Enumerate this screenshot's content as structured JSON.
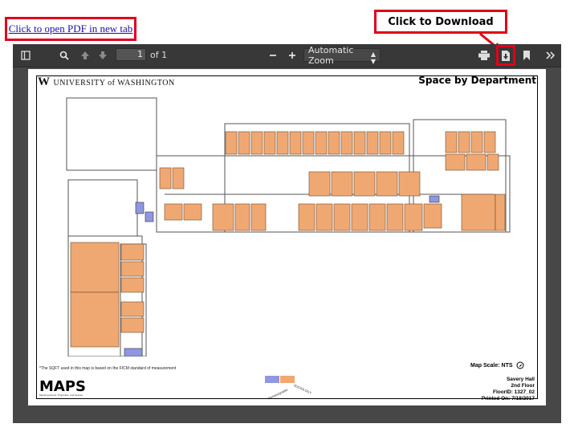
{
  "open_pdf_link": "Click to open PDF in new tab",
  "download_callout": "Click to Download",
  "toolbar": {
    "page_number": "1",
    "page_count": "of 1",
    "zoom": "Automatic Zoom",
    "icons": [
      "sidebar-toggle-icon",
      "search-icon",
      "prev-page-icon",
      "next-page-icon",
      "zoom-out-icon",
      "zoom-in-icon",
      "print-icon",
      "download-icon",
      "bookmark-icon",
      "tools-icon"
    ]
  },
  "document": {
    "logo_text": "UNIVERSITY of WASHINGTON",
    "logo_mark": "W",
    "title": "Space by Department",
    "footnote": "*The SQFT used in this map is based on the FICM standard of measurement",
    "map_scale": "Map Scale: NTS",
    "maps_logo": "MAPS",
    "maps_subtitle": "Mapping Assets, Properties, and Spaces",
    "legend": [
      {
        "label": "Nonassignable",
        "color": "#8e97e0"
      },
      {
        "label": "SOCIOLOGY",
        "color": "#f0a873"
      }
    ],
    "building": "Savery Hall",
    "floor": "2nd Floor",
    "floor_id": "FloorID: 1327_02",
    "printed_on": "Printed On: 7/18/2017"
  },
  "colors": {
    "callout_red": "#e0001a",
    "viewer_bg": "#474747",
    "toolbar_bg": "#383838",
    "dept_orange": "#f0a873",
    "nonassign_blue": "#8e97e0"
  }
}
